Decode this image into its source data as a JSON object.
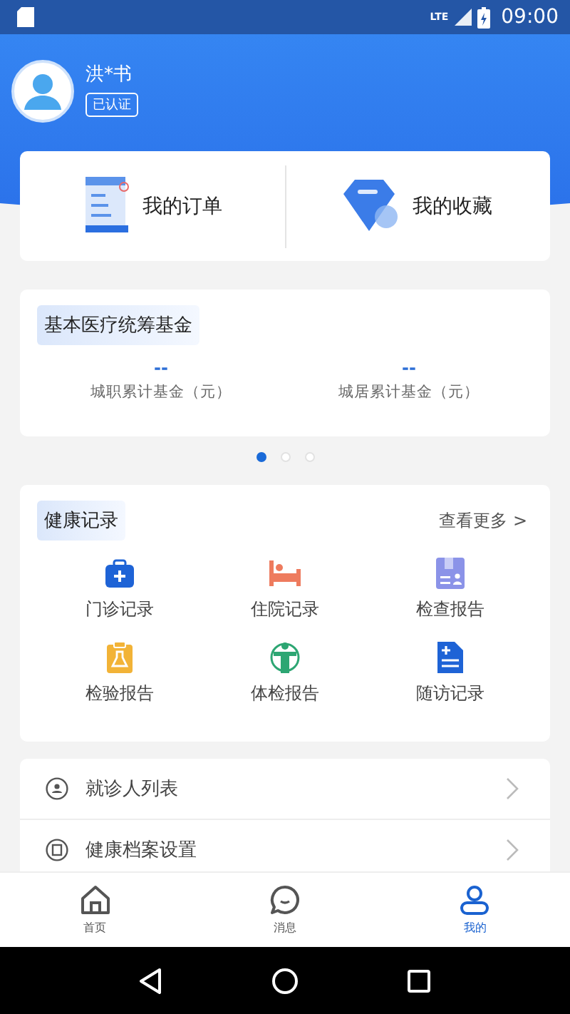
{
  "status_bar": {
    "time": "09:00",
    "network": "LTE"
  },
  "profile": {
    "name": "洪*书",
    "badge": "已认证"
  },
  "shortcuts": [
    {
      "label": "我的订单"
    },
    {
      "label": "我的收藏"
    }
  ],
  "fund": {
    "title": "基本医疗统筹基金",
    "items": [
      {
        "value": "--",
        "label": "城职累计基金（元）"
      },
      {
        "value": "--",
        "label": "城居累计基金（元）"
      }
    ]
  },
  "pager": [
    {
      "selected": true
    },
    {
      "selected": false
    },
    {
      "selected": false
    }
  ],
  "health": {
    "title": "健康记录",
    "more": "查看更多 >",
    "items": [
      {
        "label": "门诊记录"
      },
      {
        "label": "住院记录"
      },
      {
        "label": "检查报告"
      },
      {
        "label": "检验报告"
      },
      {
        "label": "体检报告"
      },
      {
        "label": "随访记录"
      }
    ]
  },
  "menu": [
    {
      "label": "就诊人列表"
    },
    {
      "label": "健康档案设置"
    }
  ],
  "tabs": [
    {
      "label": "首页",
      "selected": false
    },
    {
      "label": "消息",
      "selected": false
    },
    {
      "label": "我的",
      "selected": true
    }
  ]
}
